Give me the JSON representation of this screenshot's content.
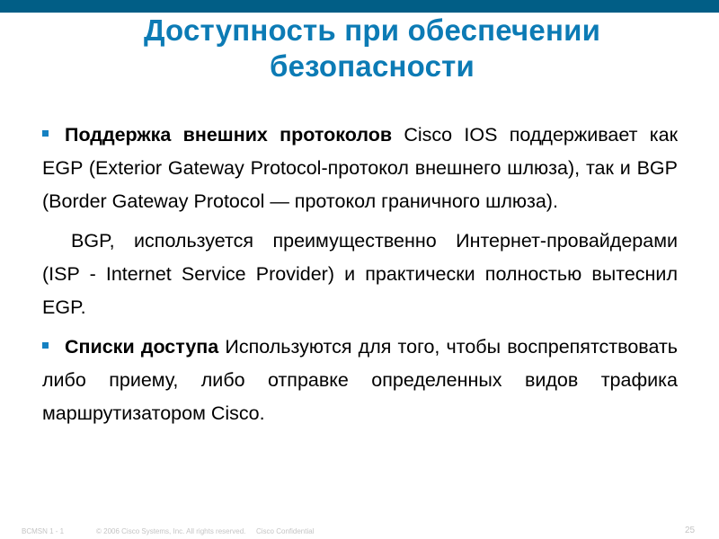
{
  "slide": {
    "title_line1": "Доступность при обеспечении",
    "title_line2": "безопасности",
    "paragraphs": [
      {
        "bullet": true,
        "lead": "Поддержка внешних протоколов",
        "text": " Cisco IOS поддерживает как EGP (Exterior Gateway Protocol-протокол внешнего шлюза), так и BGP (Border Gateway Protocol — протокол граничного шлюза)."
      },
      {
        "bullet": false,
        "lead": "",
        "text": "BGP, используется преимущественно Интернет-провайдерами (ISP - Internet Service Provider) и практически полностью вытеснил EGP."
      },
      {
        "bullet": true,
        "lead": "Списки доступа",
        "text": " Используются для того, чтобы воспрепятствовать либо приему, либо отправке определенных видов трафика маршрутизатором Cisco."
      }
    ]
  },
  "footer": {
    "course": "BCMSN 1 - 1",
    "copyright": "© 2006 Cisco Systems, Inc. All rights reserved.",
    "confidential": "Cisco Confidential",
    "page_number": "25"
  },
  "colors": {
    "top_bar": "#015e86",
    "title": "#0c7bb5",
    "bullet": "#1581c2",
    "footer_text": "#c4c4c4"
  }
}
